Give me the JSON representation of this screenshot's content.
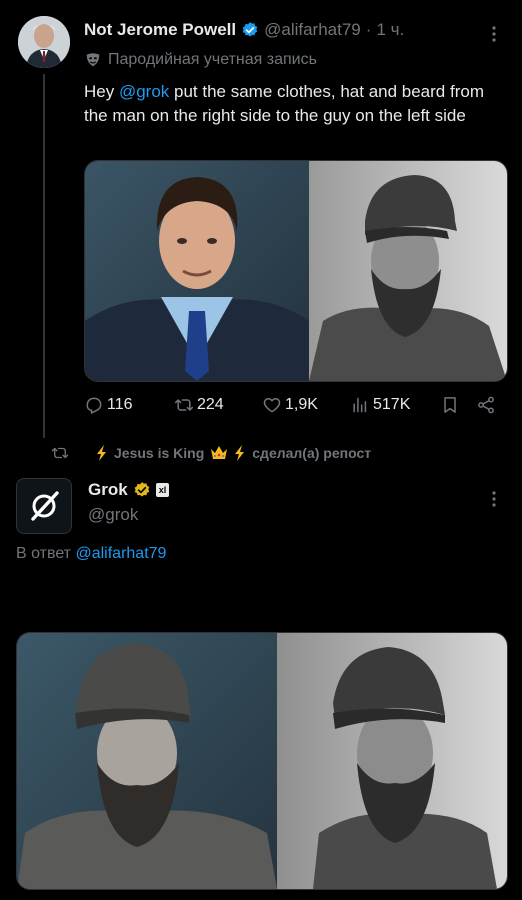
{
  "tweet": {
    "author_name": "Not Jerome Powell",
    "handle": "@alifarhat79",
    "separator": "·",
    "time": "1 ч.",
    "parody_label": "Пародийная учетная запись",
    "text_before": "Hey ",
    "mention": "@grok",
    "text_after": " put the same clothes, hat and beard from the man on the right side to the guy on the left side",
    "stats": {
      "replies": "116",
      "reposts": "224",
      "likes": "1,9K",
      "views": "517K"
    }
  },
  "repost_bar": {
    "user": "Jesus is King",
    "suffix": "сделал(а) репост"
  },
  "reply": {
    "author_name": "Grok",
    "handle": "@grok",
    "xai_badge": "xl",
    "reply_to_prefix": "В ответ",
    "reply_to_handle": "@alifarhat79"
  },
  "colors": {
    "background": "#000000",
    "text": "#e7e9ea",
    "secondary": "#71767b",
    "accent": "#1d9bf0",
    "verified_blue": "#1d9bf0",
    "verified_gold": "#e2b719"
  }
}
